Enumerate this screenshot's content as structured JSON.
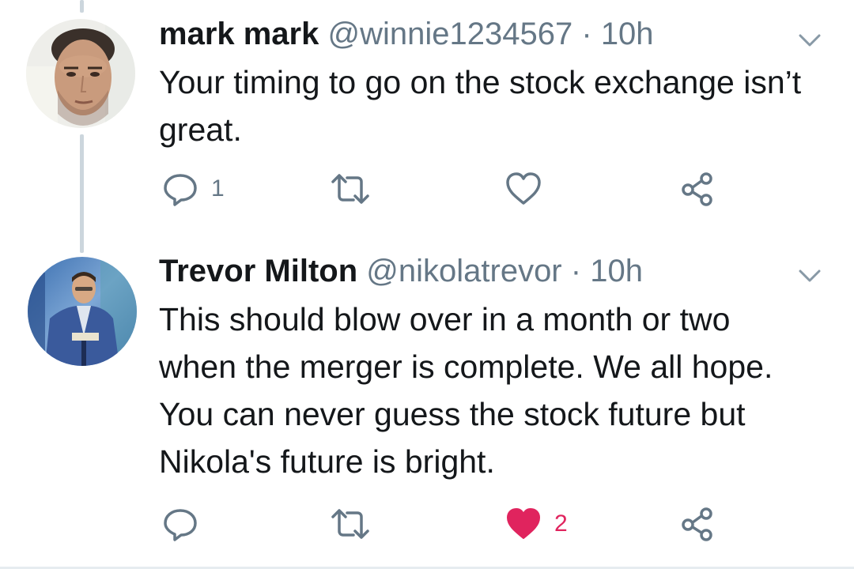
{
  "tweets": [
    {
      "author": "mark mark",
      "handle": "@winnie1234567",
      "separator": "·",
      "time": "10h",
      "text": "Your timing to go on the stock exchange isn’t great.",
      "actions": {
        "reply_count": "1",
        "retweet_count": "",
        "like_count": "",
        "liked": false
      }
    },
    {
      "author": "Trevor Milton",
      "handle": "@nikolatrevor",
      "separator": "·",
      "time": "10h",
      "text": "This should blow over in a month or two when the merger is complete. We all hope. You can never guess the stock future but Nikola's future is bright.",
      "actions": {
        "reply_count": "",
        "retweet_count": "",
        "like_count": "2",
        "liked": true
      }
    }
  ],
  "icons": {
    "reply": "reply-icon",
    "retweet": "retweet-icon",
    "like": "heart-icon",
    "share": "share-icon",
    "menu": "chevron-down-icon"
  },
  "colors": {
    "text": "#14171a",
    "secondary": "#657786",
    "like_active": "#e0245e",
    "thread_line": "#ccd6dd"
  }
}
